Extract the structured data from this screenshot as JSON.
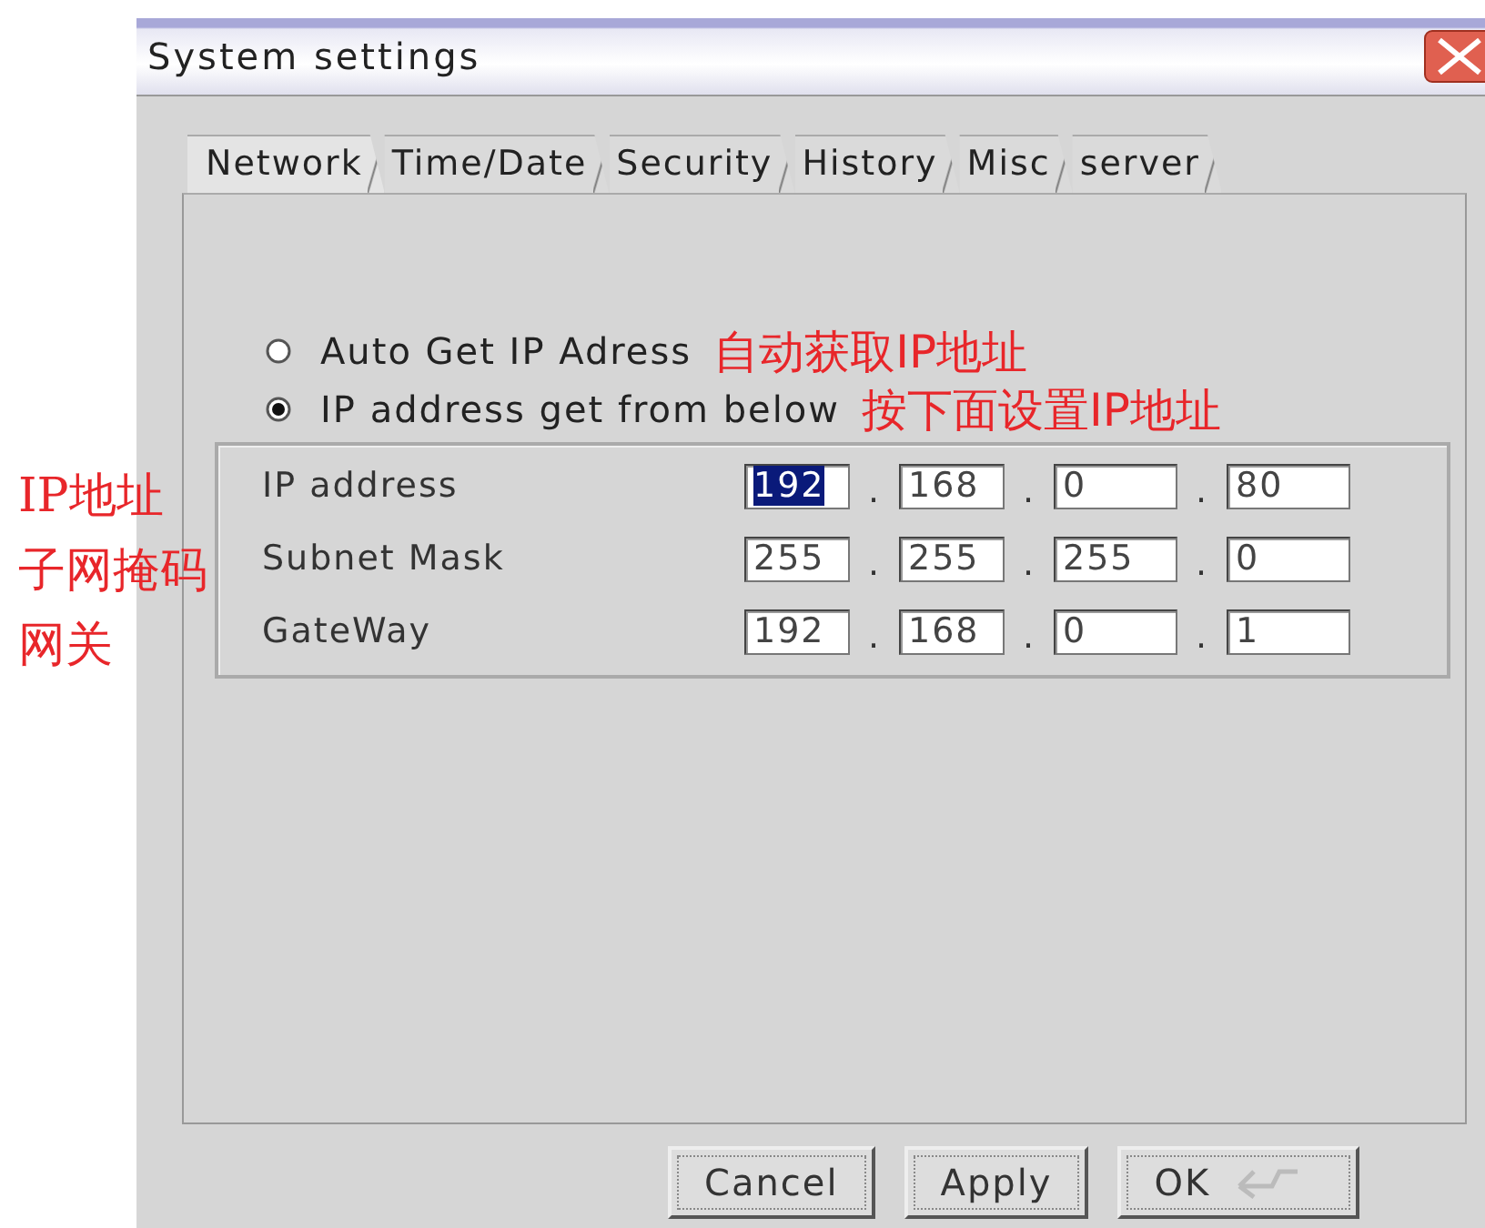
{
  "window": {
    "title": "System settings"
  },
  "tabs": [
    {
      "label": "Network",
      "selected": true
    },
    {
      "label": "Time/Date",
      "selected": false
    },
    {
      "label": "Security",
      "selected": false
    },
    {
      "label": "History",
      "selected": false
    },
    {
      "label": "Misc",
      "selected": false
    },
    {
      "label": "server",
      "selected": false
    }
  ],
  "radios": [
    {
      "label": "Auto Get IP Adress",
      "selected": false,
      "annotation": "自动获取IP地址"
    },
    {
      "label": "IP address get from below",
      "selected": true,
      "annotation": "按下面设置IP地址"
    }
  ],
  "address_rows": [
    {
      "label": "IP address",
      "separators": [
        ".",
        ".",
        "."
      ],
      "octets": [
        {
          "value": "192",
          "selected": true
        },
        {
          "value": "168",
          "selected": false
        },
        {
          "value": "0",
          "selected": false
        },
        {
          "value": "80",
          "selected": false
        }
      ]
    },
    {
      "label": "Subnet Mask",
      "separators": [
        ".",
        ".",
        "."
      ],
      "octets": [
        {
          "value": "255",
          "selected": false
        },
        {
          "value": "255",
          "selected": false
        },
        {
          "value": "255",
          "selected": false
        },
        {
          "value": "0",
          "selected": false
        }
      ]
    },
    {
      "label": "GateWay",
      "separators": [
        ".",
        ".",
        "."
      ],
      "octets": [
        {
          "value": "192",
          "selected": false
        },
        {
          "value": "168",
          "selected": false
        },
        {
          "value": "0",
          "selected": false
        },
        {
          "value": "1",
          "selected": false
        }
      ]
    }
  ],
  "side_annotations": [
    "IP地址",
    "子网掩码",
    "网关"
  ],
  "buttons": [
    {
      "label": "Cancel",
      "kind": "plain"
    },
    {
      "label": "Apply",
      "kind": "plain"
    },
    {
      "label": "OK",
      "kind": "enter"
    }
  ]
}
